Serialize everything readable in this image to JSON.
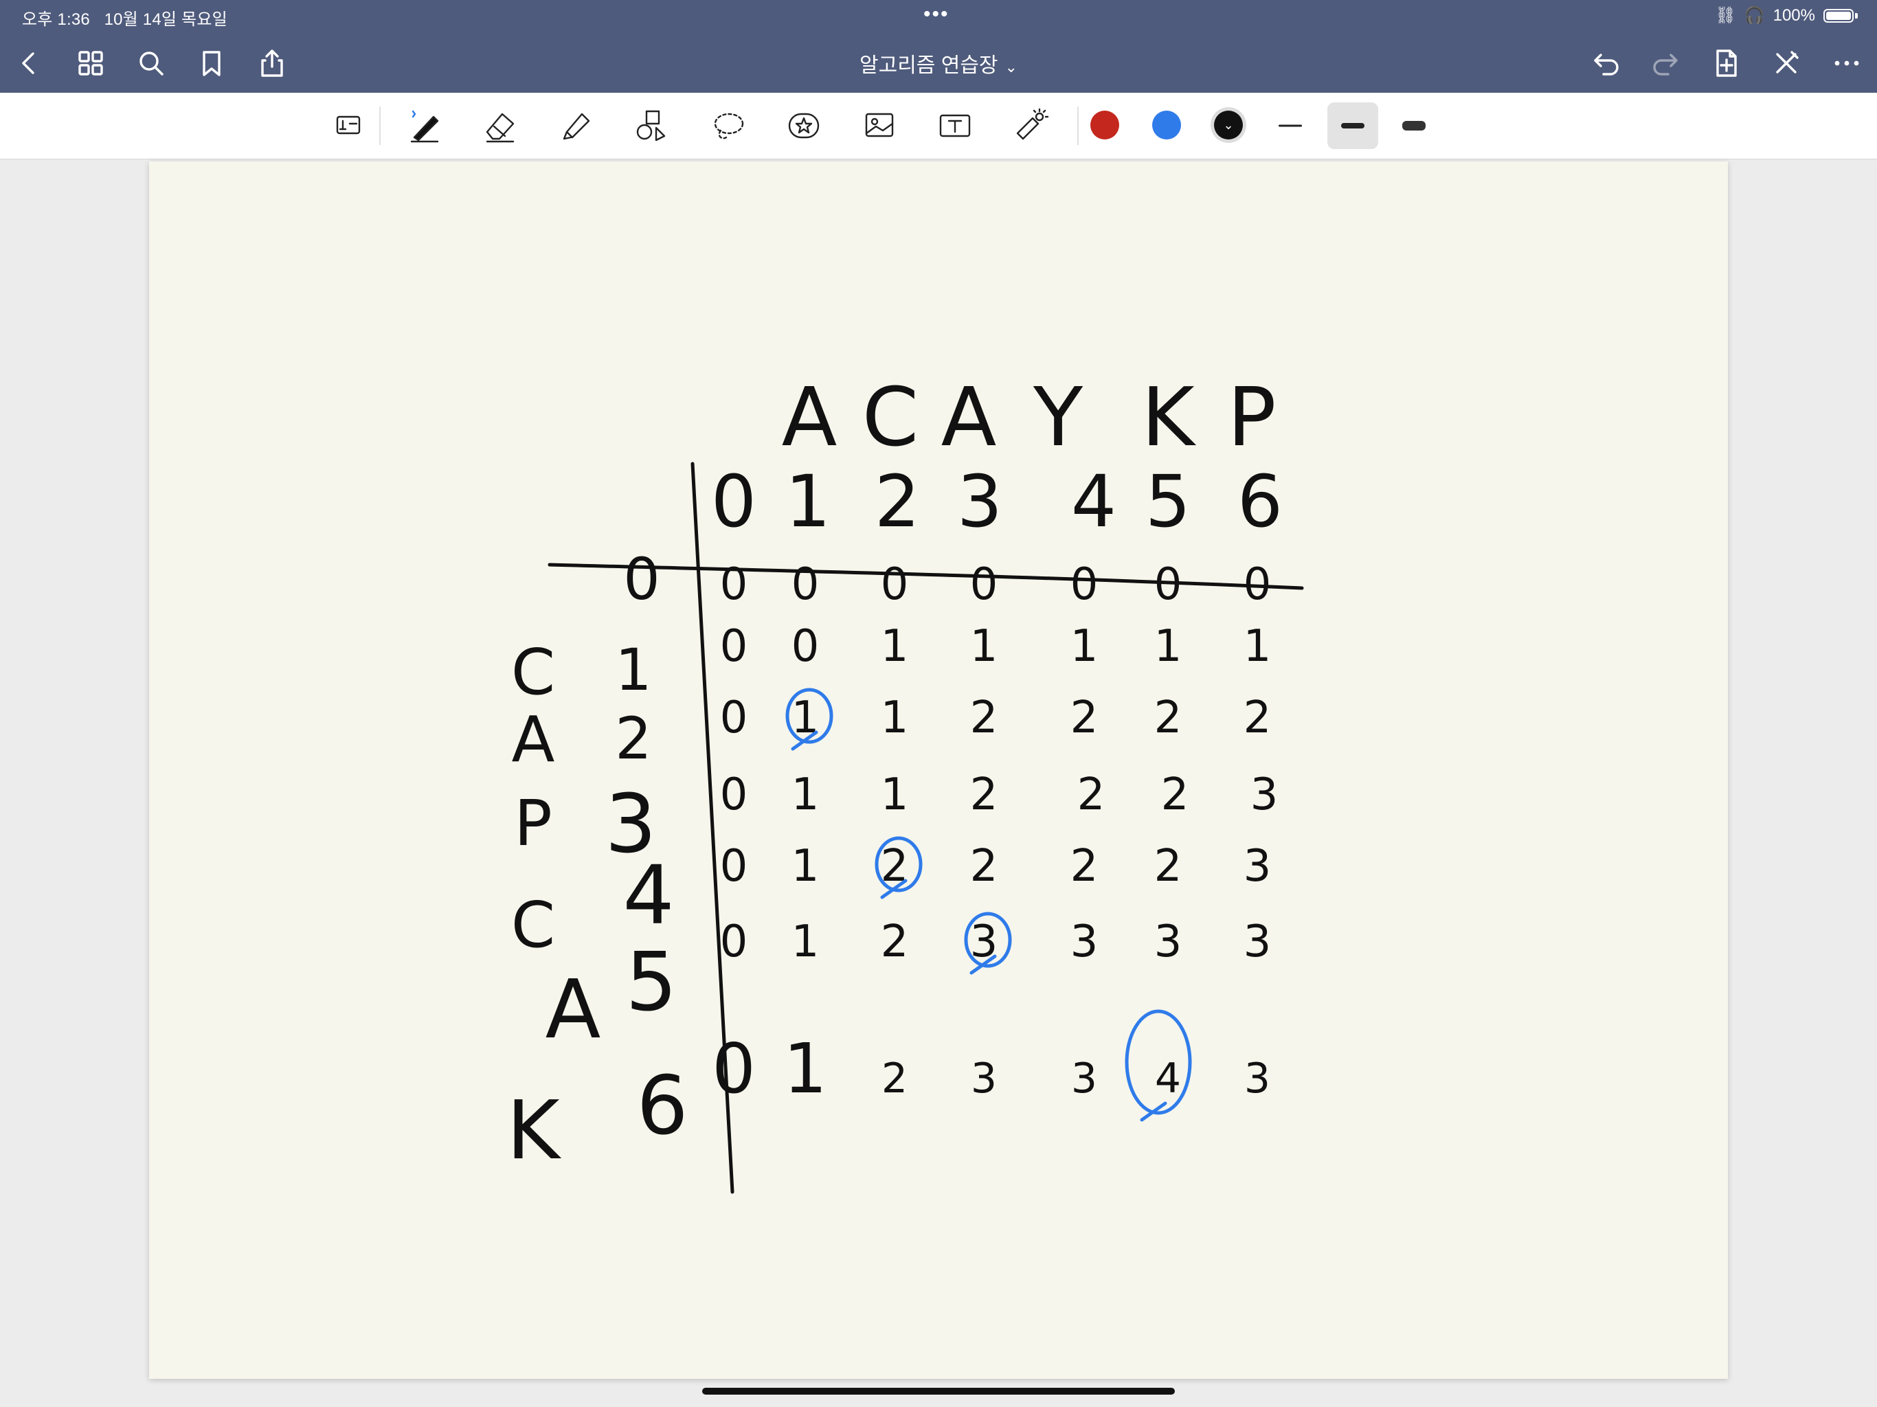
{
  "status": {
    "time": "오후 1:36",
    "date": "10월 14일 목요일",
    "battery": "100%"
  },
  "nav": {
    "title": "알고리즘 연습장",
    "title_caret": "⌄"
  },
  "toolbar": {
    "colors": [
      "#c4271d",
      "#2f7bea",
      "#111111"
    ],
    "selected_color": "#111111",
    "selected_stroke": "medium"
  },
  "notes": {
    "column_letters": [
      "A",
      "C",
      "A",
      "Y",
      "K",
      "P"
    ],
    "column_indices": [
      "0",
      "1",
      "2",
      "3",
      "4",
      "5",
      "6"
    ],
    "row_letters": [
      "C",
      "A",
      "P",
      "C",
      "A",
      "K"
    ],
    "row_indices": [
      "0",
      "1",
      "2",
      "3",
      "4",
      "5",
      "6"
    ],
    "table": [
      [
        "0",
        "0",
        "0",
        "0",
        "0",
        "0",
        "0"
      ],
      [
        "0",
        "0",
        "1",
        "1",
        "1",
        "1",
        "1"
      ],
      [
        "0",
        "1",
        "1",
        "2",
        "2",
        "2",
        "2"
      ],
      [
        "0",
        "1",
        "1",
        "2",
        "2",
        "2",
        "3"
      ],
      [
        "0",
        "1",
        "2",
        "2",
        "2",
        "2",
        "3"
      ],
      [
        "0",
        "1",
        "2",
        "3",
        "3",
        "3",
        "3"
      ],
      [
        "0",
        "1",
        "2",
        "3",
        "3",
        "4",
        "3"
      ]
    ],
    "circled_cells": [
      [
        2,
        1
      ],
      [
        4,
        2
      ],
      [
        5,
        3
      ],
      [
        6,
        5
      ]
    ]
  }
}
